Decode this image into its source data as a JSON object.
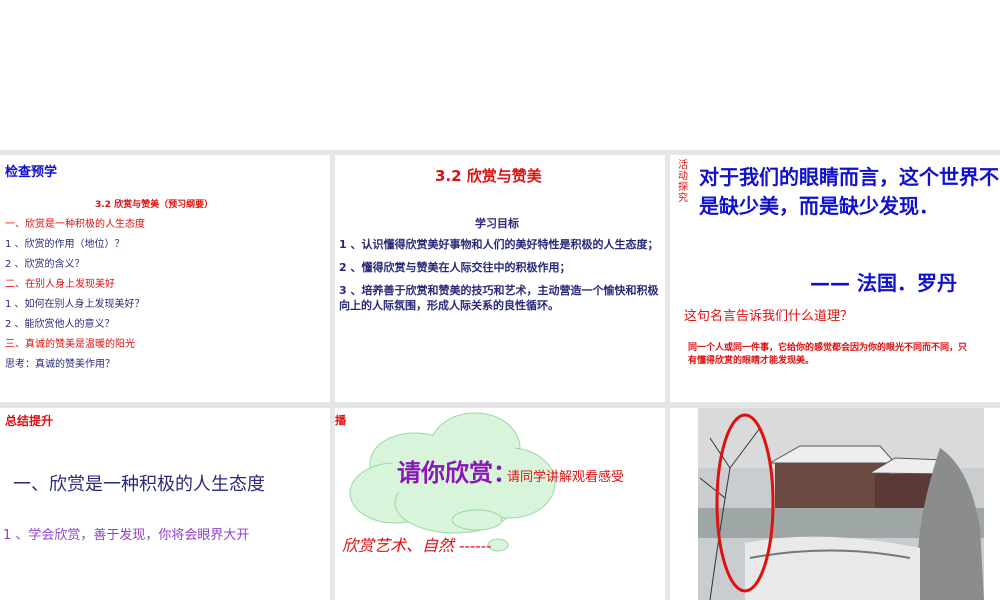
{
  "slides": [
    {
      "title": "检查预学",
      "subtitle": "3.2  欣赏与赞美（预习纲要）",
      "lines": [
        {
          "text": "一、欣赏是一种积极的人生态度",
          "color": "red"
        },
        {
          "text": "1 、欣赏的作用（地位）？",
          "color": "navy"
        },
        {
          "text": "2 、欣赏的含义？",
          "color": "navy"
        },
        {
          "text": "二、在别人身上发现美好",
          "color": "red"
        },
        {
          "text": "1 、如何在别人身上发现美好？",
          "color": "navy"
        },
        {
          "text": "2 、能欣赏他人的意义？",
          "color": "navy"
        },
        {
          "text": "三、真诚的赞美是温暖的阳光",
          "color": "red"
        },
        {
          "text": "思考：真诚的赞美作用？",
          "color": "navy"
        }
      ]
    },
    {
      "title": "3.2    欣赏与赞美",
      "heading": "学习目标",
      "goals": [
        "1 、认识懂得欣赏美好事物和人们的美好特性是积极的人生态度；",
        "2 、懂得欣赏与赞美在人际交往中的积极作用；",
        "3 、培养善于欣赏和赞美的技巧和艺术，主动营造一个愉快和积极向上的人际氛围，形成人际关系的良性循环。"
      ]
    },
    {
      "label": "活动探究",
      "quote": "对于我们的眼睛而言，这个世界不是缺少美，而是缺少发现．",
      "author": "——  法国．罗丹",
      "question": "这句名言告诉我们什么道理？",
      "answer": "同一个人或同一件事，它给你的感觉都会因为你的眼光不同而不同，只有懂得欣赏的眼睛才能发现美。"
    },
    {
      "title": "总结提升",
      "heading": "一、欣赏是一种积极的人生态度",
      "point": "1 、学会欣赏，善于发现，你将会眼界大开"
    },
    {
      "corner": "播",
      "cloud_text": "请你欣赏：",
      "prompt": "请同学讲解观看感受",
      "italic": "欣赏艺术、自然 ------"
    },
    {
      "image": "snowy-garden-photo"
    }
  ],
  "colors": {
    "red": "#e01010",
    "navy": "#2a2a7a",
    "blue": "#1010d0",
    "purple": "#8a18b8",
    "violet": "#9040d0",
    "cloud": "#d8f5dc"
  }
}
